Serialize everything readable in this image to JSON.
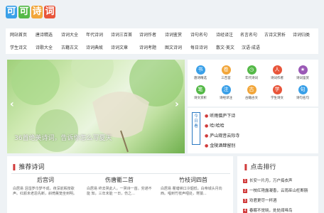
{
  "logo": {
    "chars": [
      "可",
      "可",
      "诗",
      "词"
    ],
    "colors": [
      "#3aa0e8",
      "#55b948",
      "#f2a63a",
      "#e8553a"
    ]
  },
  "nav": {
    "row1": [
      "网站首页",
      "唐诗精选",
      "诗词大全",
      "年代诗词",
      "诗词三百首",
      "诗词作者",
      "诗词鉴赏",
      "诗句名句",
      "诗经译注",
      "名言名句",
      "古诗文赏析",
      "诗词归类"
    ],
    "row2": [
      "学生诗文",
      "诗歌大全",
      "古籍古文",
      "诗词典故",
      "诗词文章",
      "诗词考题",
      "图文诗词",
      "每日诗词",
      "散文·美文",
      "汉语·成语"
    ]
  },
  "hero": {
    "caption": "36首绝美诗词，告诉你怎么写夏天",
    "prev_arrow": "‹",
    "next_arrow": "›"
  },
  "quick_grid": [
    {
      "label": "唐诗精选",
      "icon": "book-icon",
      "glyph": "书",
      "color": "#3aa0e8"
    },
    {
      "label": "三百首",
      "icon": "scroll-icon",
      "glyph": "卷",
      "color": "#f2a63a"
    },
    {
      "label": "年代诗词",
      "icon": "clock-icon",
      "glyph": "◷",
      "color": "#55b948"
    },
    {
      "label": "诗词作者",
      "icon": "user-icon",
      "glyph": "人",
      "color": "#e8553a"
    },
    {
      "label": "诗词鉴赏",
      "icon": "star-icon",
      "glyph": "★",
      "color": "#9b59b6"
    },
    {
      "label": "诗文赏析",
      "icon": "pen-icon",
      "glyph": "笔",
      "color": "#55b948"
    },
    {
      "label": "诗经译注",
      "icon": "note-icon",
      "glyph": "注",
      "color": "#3aa0e8"
    },
    {
      "label": "古籍古文",
      "icon": "scroll-icon",
      "glyph": "古",
      "color": "#f2a63a"
    },
    {
      "label": "学生诗文",
      "icon": "student-icon",
      "glyph": "学",
      "color": "#e8553a"
    },
    {
      "label": "诗句名句",
      "icon": "quote-icon",
      "glyph": "句",
      "color": "#3aa0e8"
    }
  ],
  "news": {
    "tab_label": "今日看",
    "items": [
      "听雨僧庐下诗",
      "哈!哈哈",
      "庐山观音云际寺",
      "金陵酒肆留别"
    ]
  },
  "recommend": {
    "title": "推荐诗词",
    "poems": [
      {
        "title": "后宫词",
        "text": "白居易 泪湿罗巾梦不成，夜深前殿按歌声。红颜未老恩先断，斜倚薰笼坐到明。"
      },
      {
        "title": "伤唐衢二首",
        "text": "白居易 终去哭此人，一哭诗一首。穷通不能 知，三年未能 一日，伤之..."
      },
      {
        "title": "竹枝词四首",
        "text": "白居易 瞿塘峡口冷烟低，白帝城头月向西。唱到竹枝声咽处，寒猿..."
      }
    ]
  },
  "ranking": {
    "title": "点击排行",
    "items": [
      "长安一片月，万户捣衣声",
      "一枝红艳露凝香，云雨巫山枉断肠",
      "劝君更尽一杯酒",
      "春眠不觉晓，处处闻啼鸟"
    ]
  }
}
